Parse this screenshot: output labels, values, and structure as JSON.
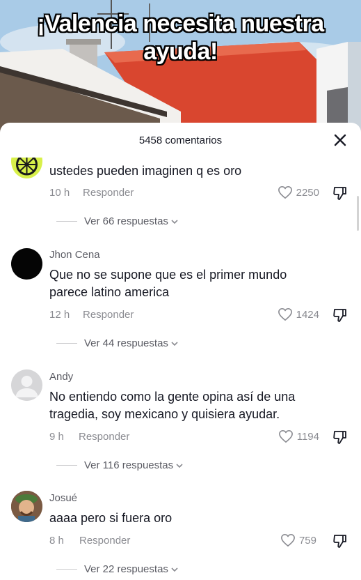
{
  "video": {
    "headline_line1": "¡Valencia necesita nuestra",
    "headline_line2": "ayuda!"
  },
  "sheet": {
    "comment_count": "5458 comentarios",
    "close_icon": "close-icon"
  },
  "comments": [
    {
      "username": "",
      "text": "ustedes pueden imaginen q es oro",
      "time": "10 h",
      "reply_label": "Responder",
      "likes": "2250",
      "replies_label": "Ver 66 respuestas",
      "avatar": "lime-avatar"
    },
    {
      "username": "Jhon Cena",
      "text": "Que no se supone que es el primer mundo parece latino america",
      "time": "12 h",
      "reply_label": "Responder",
      "likes": "1424",
      "replies_label": "Ver 44 respuestas",
      "avatar": "black-avatar"
    },
    {
      "username": "Andy",
      "text": "No entiendo como la gente opina así de una tragedia, soy mexicano y quisiera ayudar.",
      "time": "9 h",
      "reply_label": "Responder",
      "likes": "1194",
      "replies_label": "Ver 116 respuestas",
      "avatar": "default-avatar"
    },
    {
      "username": "Josué",
      "text": "aaaa pero si fuera oro",
      "time": "8 h",
      "reply_label": "Responder",
      "likes": "759",
      "replies_label": "Ver 22 respuestas",
      "avatar": "character-avatar"
    }
  ],
  "colors": {
    "text_primary": "#161823",
    "text_secondary": "#8a8b91",
    "username": "#5a5b63"
  }
}
